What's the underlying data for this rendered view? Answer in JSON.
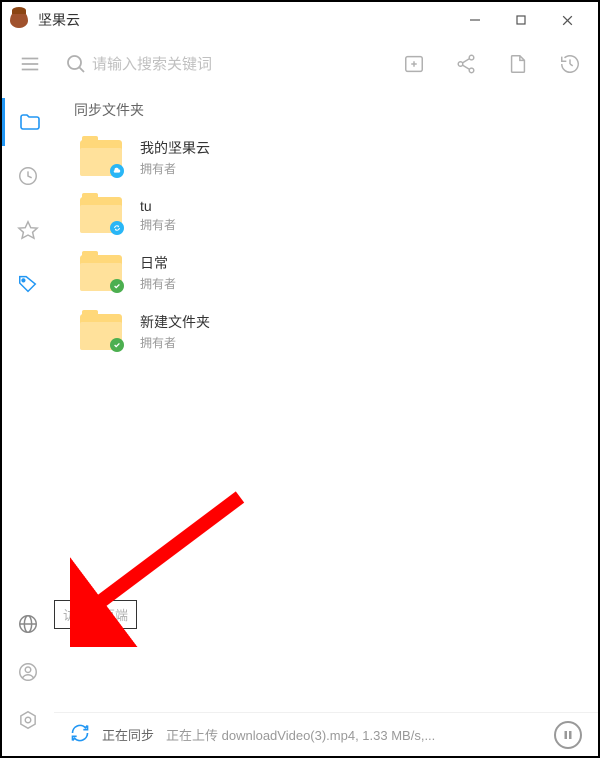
{
  "app": {
    "title": "坚果云"
  },
  "search": {
    "placeholder": "请输入搜索关键词"
  },
  "content": {
    "section_title": "同步文件夹",
    "folders": [
      {
        "name": "我的坚果云",
        "subtitle": "拥有者",
        "badge": "cloud"
      },
      {
        "name": "tu",
        "subtitle": "拥有者",
        "badge": "sync"
      },
      {
        "name": "日常",
        "subtitle": "拥有者",
        "badge": "check"
      },
      {
        "name": "新建文件夹",
        "subtitle": "拥有者",
        "badge": "check"
      }
    ]
  },
  "tooltip": {
    "web_access": "访问网页端"
  },
  "status": {
    "label": "正在同步",
    "detail": "正在上传  downloadVideo(3).mp4, 1.33 MB/s,..."
  }
}
